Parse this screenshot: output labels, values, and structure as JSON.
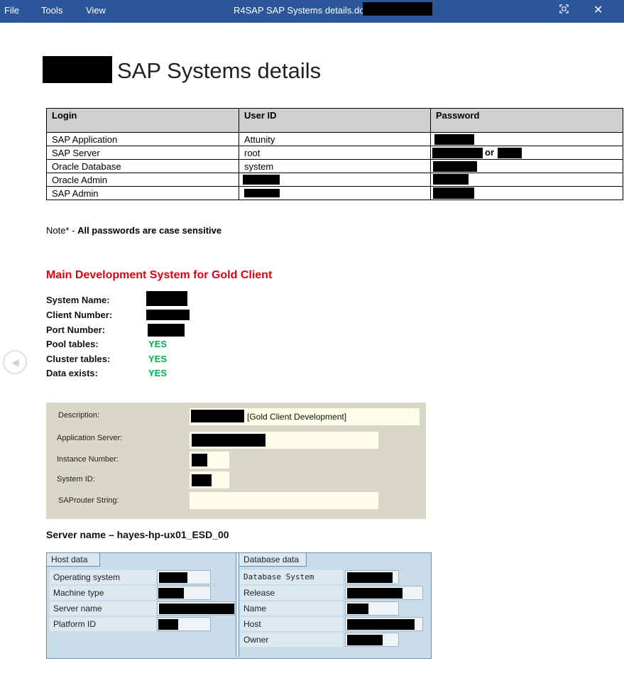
{
  "titlebar": {
    "menu": [
      "File",
      "Tools",
      "View"
    ],
    "document_title": "R4SAP SAP Systems details.docx -",
    "fullscreen_icon": "fullscreen-icon",
    "close_icon": "close-icon",
    "color": "#2b579a"
  },
  "document": {
    "title_suffix": "SAP Systems details",
    "login_table": {
      "headers": [
        "Login",
        "User ID",
        "Password"
      ],
      "rows": [
        {
          "login": "SAP Application",
          "user_id": "Attunity"
        },
        {
          "login": "SAP Server",
          "user_id": "root",
          "password_joiner": "or"
        },
        {
          "login": "Oracle Database",
          "user_id": "system"
        },
        {
          "login": "Oracle Admin",
          "user_id": ""
        },
        {
          "login": "SAP Admin",
          "user_id": ""
        }
      ]
    },
    "note": {
      "prefix": "Note* - ",
      "text": "All passwords are case sensitive"
    },
    "main_system": {
      "title": "Main Development System for Gold Client",
      "title_color": "#e2000f",
      "properties": [
        {
          "label": "System Name:",
          "value": ""
        },
        {
          "label": "Client Number:",
          "value": ""
        },
        {
          "label": "Port Number:",
          "value": ""
        },
        {
          "label": "Pool tables:",
          "value": "YES"
        },
        {
          "label": "Cluster tables:",
          "value": "YES"
        },
        {
          "label": "Data exists:",
          "value": "YES"
        }
      ],
      "yes_color": "#00b050"
    },
    "sap_panel": {
      "description_label": "Description:",
      "description_value": "[Gold Client Development]",
      "application_server_label": "Application Server:",
      "instance_number_label": "Instance Number:",
      "system_id_label": "System ID:",
      "saprouter_label": "SAProuter String:"
    },
    "server_name_heading": "Server name – hayes-hp-ux01_ESD_00",
    "host_data": {
      "title": "Host data",
      "fields": [
        "Operating system",
        "Machine type",
        "Server name",
        "Platform ID"
      ]
    },
    "database_data": {
      "title": "Database data",
      "fields": [
        "Database System",
        "Release",
        "Name",
        "Host",
        "Owner"
      ]
    }
  },
  "nav": {
    "prev_icon": "chevron-left-icon"
  }
}
